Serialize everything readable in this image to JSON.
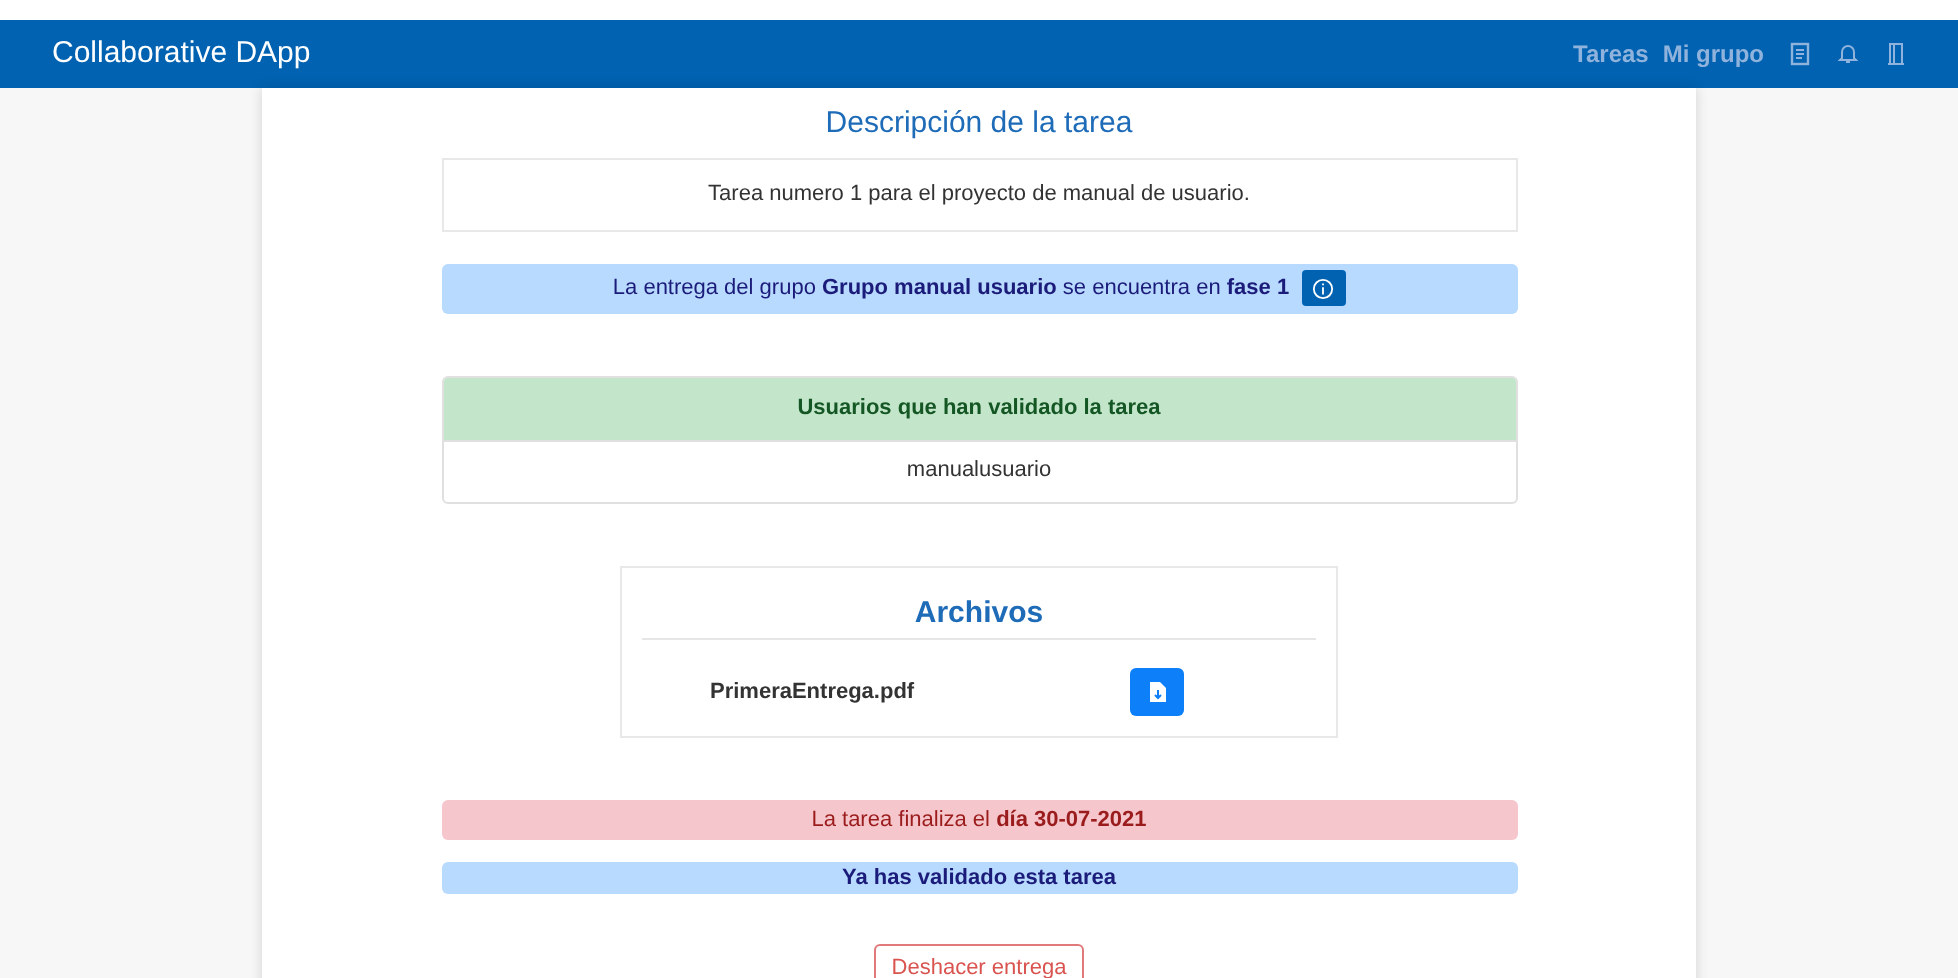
{
  "navbar": {
    "brand": "Collaborative DApp",
    "links": [
      "Tareas",
      "Mi grupo"
    ]
  },
  "description": {
    "title": "Descripción de la tarea",
    "text": "Tarea numero 1 para el proyecto de manual de usuario."
  },
  "phase_notice": "La entrega del grupo **Grupo manual usuario** se encuentra en **fase 1**",
  "validators": {
    "header": "Usuarios que han validado la tarea",
    "users": [
      "manualusuario"
    ]
  },
  "files": {
    "title": "Archivos",
    "items": [
      {
        "name": "PrimeraEntrega.pdf"
      }
    ]
  },
  "deadline": "La tarea finaliza el **día 30-07-2021**",
  "validated_notice": "Ya has validado esta tarea",
  "undo_button": "Deshacer entrega"
}
